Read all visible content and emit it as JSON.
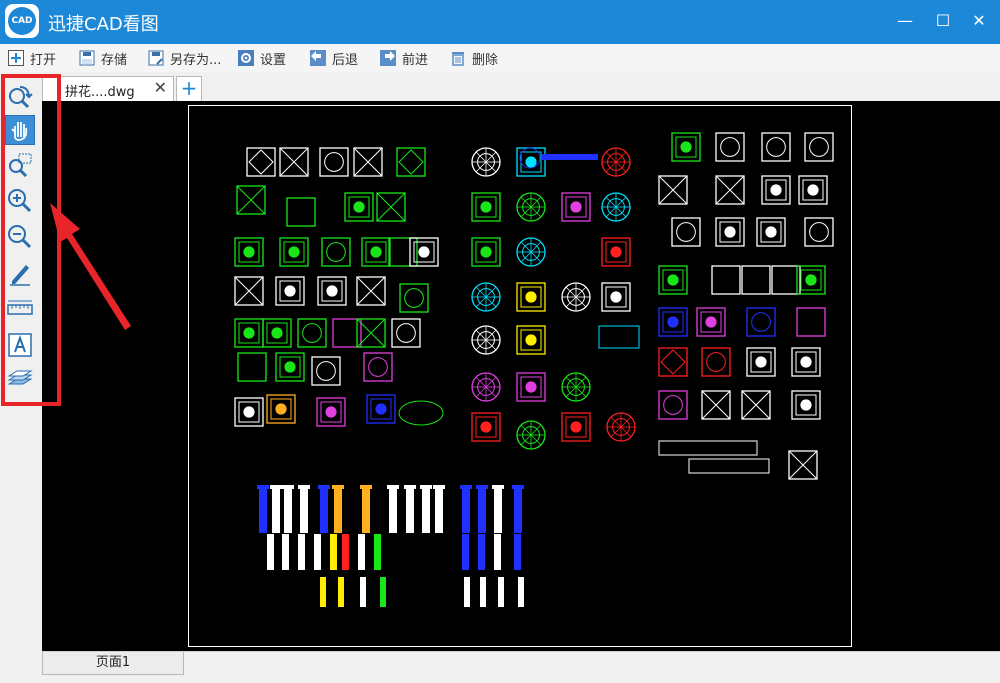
{
  "app": {
    "title": "迅捷CAD看图",
    "logo_text": "CAD"
  },
  "window": {
    "minimize_glyph": "—",
    "maximize_glyph": "☐",
    "close_glyph": "✕"
  },
  "menu": [
    {
      "label": "打开",
      "icon": "plus-icon"
    },
    {
      "label": "存储",
      "icon": "save-icon"
    },
    {
      "label": "另存为...",
      "icon": "save-as-icon"
    },
    {
      "label": "设置",
      "icon": "gear-icon"
    },
    {
      "label": "后退",
      "icon": "back-arrow-icon"
    },
    {
      "label": "前进",
      "icon": "forward-arrow-icon"
    },
    {
      "label": "删除",
      "icon": "trash-icon"
    }
  ],
  "tabs": {
    "active_label": "拼花....dwg",
    "close_glyph": "✕",
    "new_glyph": "+"
  },
  "tools": [
    {
      "name": "zoom-undo-tool",
      "icon": "magnifier-undo-icon"
    },
    {
      "name": "pan-tool",
      "icon": "hand-icon",
      "active": true
    },
    {
      "name": "zoom-window-tool",
      "icon": "magnifier-window-icon"
    },
    {
      "name": "zoom-in-tool",
      "icon": "zoom-in-icon"
    },
    {
      "name": "zoom-out-tool",
      "icon": "zoom-out-icon"
    },
    {
      "name": "markup-tool",
      "icon": "pencil-icon"
    },
    {
      "name": "measure-tool",
      "icon": "ruler-icon"
    },
    {
      "name": "text-tool",
      "icon": "text-a-icon"
    },
    {
      "name": "layers-tool",
      "icon": "layers-icon"
    }
  ],
  "colors": {
    "accent": "#1e88d8",
    "highlight": "#e8252a",
    "canvas": "#000000"
  },
  "status": {
    "page_tab": "页面1"
  }
}
